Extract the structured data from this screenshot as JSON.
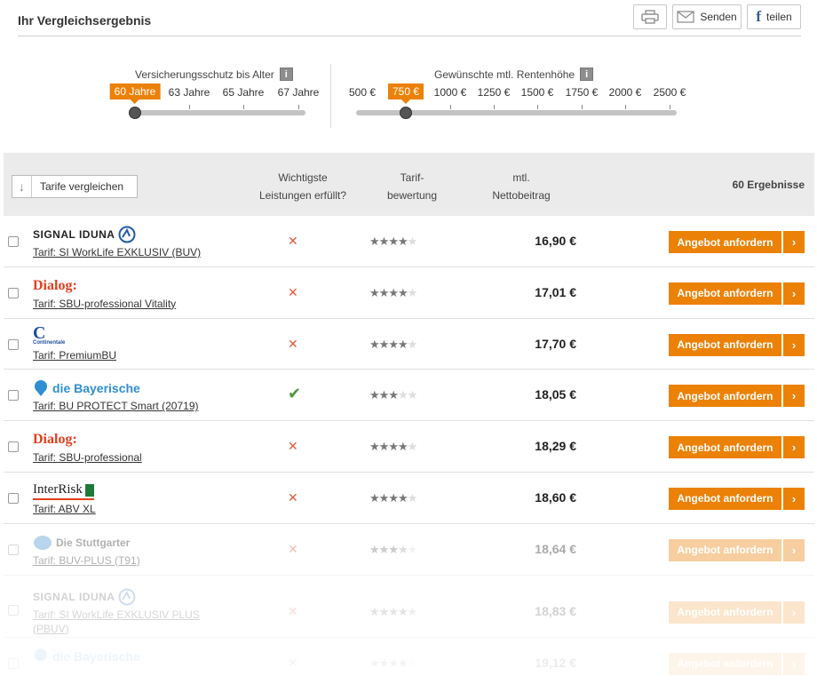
{
  "header": {
    "title": "Ihr Vergleichsergebnis",
    "send_label": "Senden",
    "share_label": "teilen",
    "share_icon": "f"
  },
  "age_slider": {
    "title": "Versicherungsschutz bis Alter",
    "options": [
      "60 Jahre",
      "63 Jahre",
      "65 Jahre",
      "67 Jahre"
    ],
    "selected": "60 Jahre",
    "info": "i"
  },
  "rent_slider": {
    "title": "Gewünschte mtl. Rentenhöhe",
    "options": [
      "500 €",
      "750 €",
      "1000 €",
      "1250 €",
      "1500 €",
      "1750 €",
      "2000 €",
      "2500 €"
    ],
    "selected": "750 €",
    "info": "i"
  },
  "table_header": {
    "compare_label": "Tarife vergleichen",
    "col_services_1": "Wichtigste",
    "col_services_2": "Leistungen erfüllt?",
    "col_rating_1": "Tarif-",
    "col_rating_2": "bewertung",
    "col_price_1": "mtl.",
    "col_price_2": "Nettobeitrag",
    "results_count": "60 Ergebnisse"
  },
  "cta_label": "Angebot anfordern",
  "rows": [
    {
      "insurer": "SIGNAL IDUNA",
      "tarif": "Tarif: SI WorkLife EXKLUSIV (BUV)",
      "fulfilled": false,
      "rating": 4,
      "price": "16,90 €"
    },
    {
      "insurer": "Dialog:",
      "tarif": "Tarif: SBU-professional Vitality",
      "fulfilled": false,
      "rating": 4,
      "price": "17,01 €"
    },
    {
      "insurer": "Continentale",
      "tarif": "Tarif: PremiumBU",
      "fulfilled": false,
      "rating": 4,
      "price": "17,70 €"
    },
    {
      "insurer": "die Bayerische",
      "tarif": "Tarif: BU PROTECT Smart (20719)",
      "fulfilled": true,
      "rating": 3,
      "price": "18,05 €"
    },
    {
      "insurer": "Dialog:",
      "tarif": "Tarif: SBU-professional",
      "fulfilled": false,
      "rating": 4,
      "price": "18,29 €"
    },
    {
      "insurer": "InterRisk",
      "tarif": "Tarif: ABV XL",
      "fulfilled": false,
      "rating": 4,
      "price": "18,60 €"
    },
    {
      "insurer": "Die Stuttgarter",
      "tarif": "Tarif: BUV-PLUS (T91)",
      "fulfilled": false,
      "rating": 3.5,
      "price": "18,64 €"
    },
    {
      "insurer": "SIGNAL IDUNA",
      "tarif": "Tarif: SI WorkLife EXKLUSIV PLUS (PBUV)",
      "fulfilled": false,
      "rating": 4.5,
      "price": "18,83 €"
    },
    {
      "insurer": "die Bayerische",
      "tarif": "",
      "fulfilled": false,
      "rating": 4,
      "price": "19,12 €"
    }
  ],
  "colors": {
    "accent": "#ec8107",
    "cross": "#e05a3a",
    "check": "#4a9a3a"
  }
}
